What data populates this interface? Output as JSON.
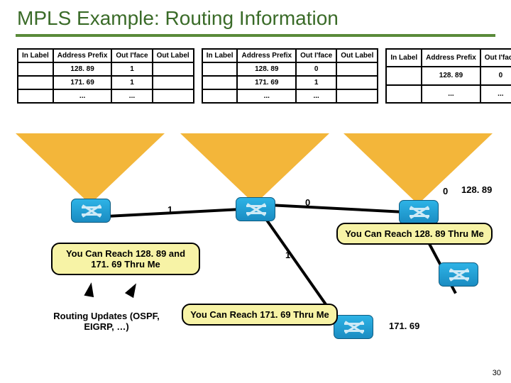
{
  "title": "MPLS Example:  Routing Information",
  "headers": {
    "in_label": "In Label",
    "addr": "Address Prefix",
    "out_iface": "Out I'face",
    "out_label": "Out Label"
  },
  "tables": [
    {
      "rows": [
        {
          "in": "",
          "addr": "128. 89",
          "iface": "1",
          "out": ""
        },
        {
          "in": "",
          "addr": "171. 69",
          "iface": "1",
          "out": ""
        },
        {
          "in": "",
          "addr": "...",
          "iface": "...",
          "out": ""
        }
      ]
    },
    {
      "rows": [
        {
          "in": "",
          "addr": "128. 89",
          "iface": "0",
          "out": ""
        },
        {
          "in": "",
          "addr": "171. 69",
          "iface": "1",
          "out": ""
        },
        {
          "in": "",
          "addr": "...",
          "iface": "...",
          "out": ""
        }
      ]
    },
    {
      "rows": [
        {
          "in": "",
          "addr": "128. 89",
          "iface": "0",
          "out": ""
        },
        {
          "in": "",
          "addr": "...",
          "iface": "...",
          "out": ""
        }
      ]
    }
  ],
  "annot": {
    "port1": "1",
    "port0": "0",
    "port1b": "1",
    "port0b": "0",
    "bubble_left": "You Can Reach 128. 89 and 171. 69 Thru Me",
    "bubble_right": "You Can Reach 128. 89 Thru Me",
    "bubble_bottom": "You Can Reach 171. 69 Thru Me",
    "routing_updates": "Routing Updates (OSPF, EIGRP, …)",
    "net_a": "128. 89",
    "net_b": "171. 69"
  },
  "pagenum": "30"
}
